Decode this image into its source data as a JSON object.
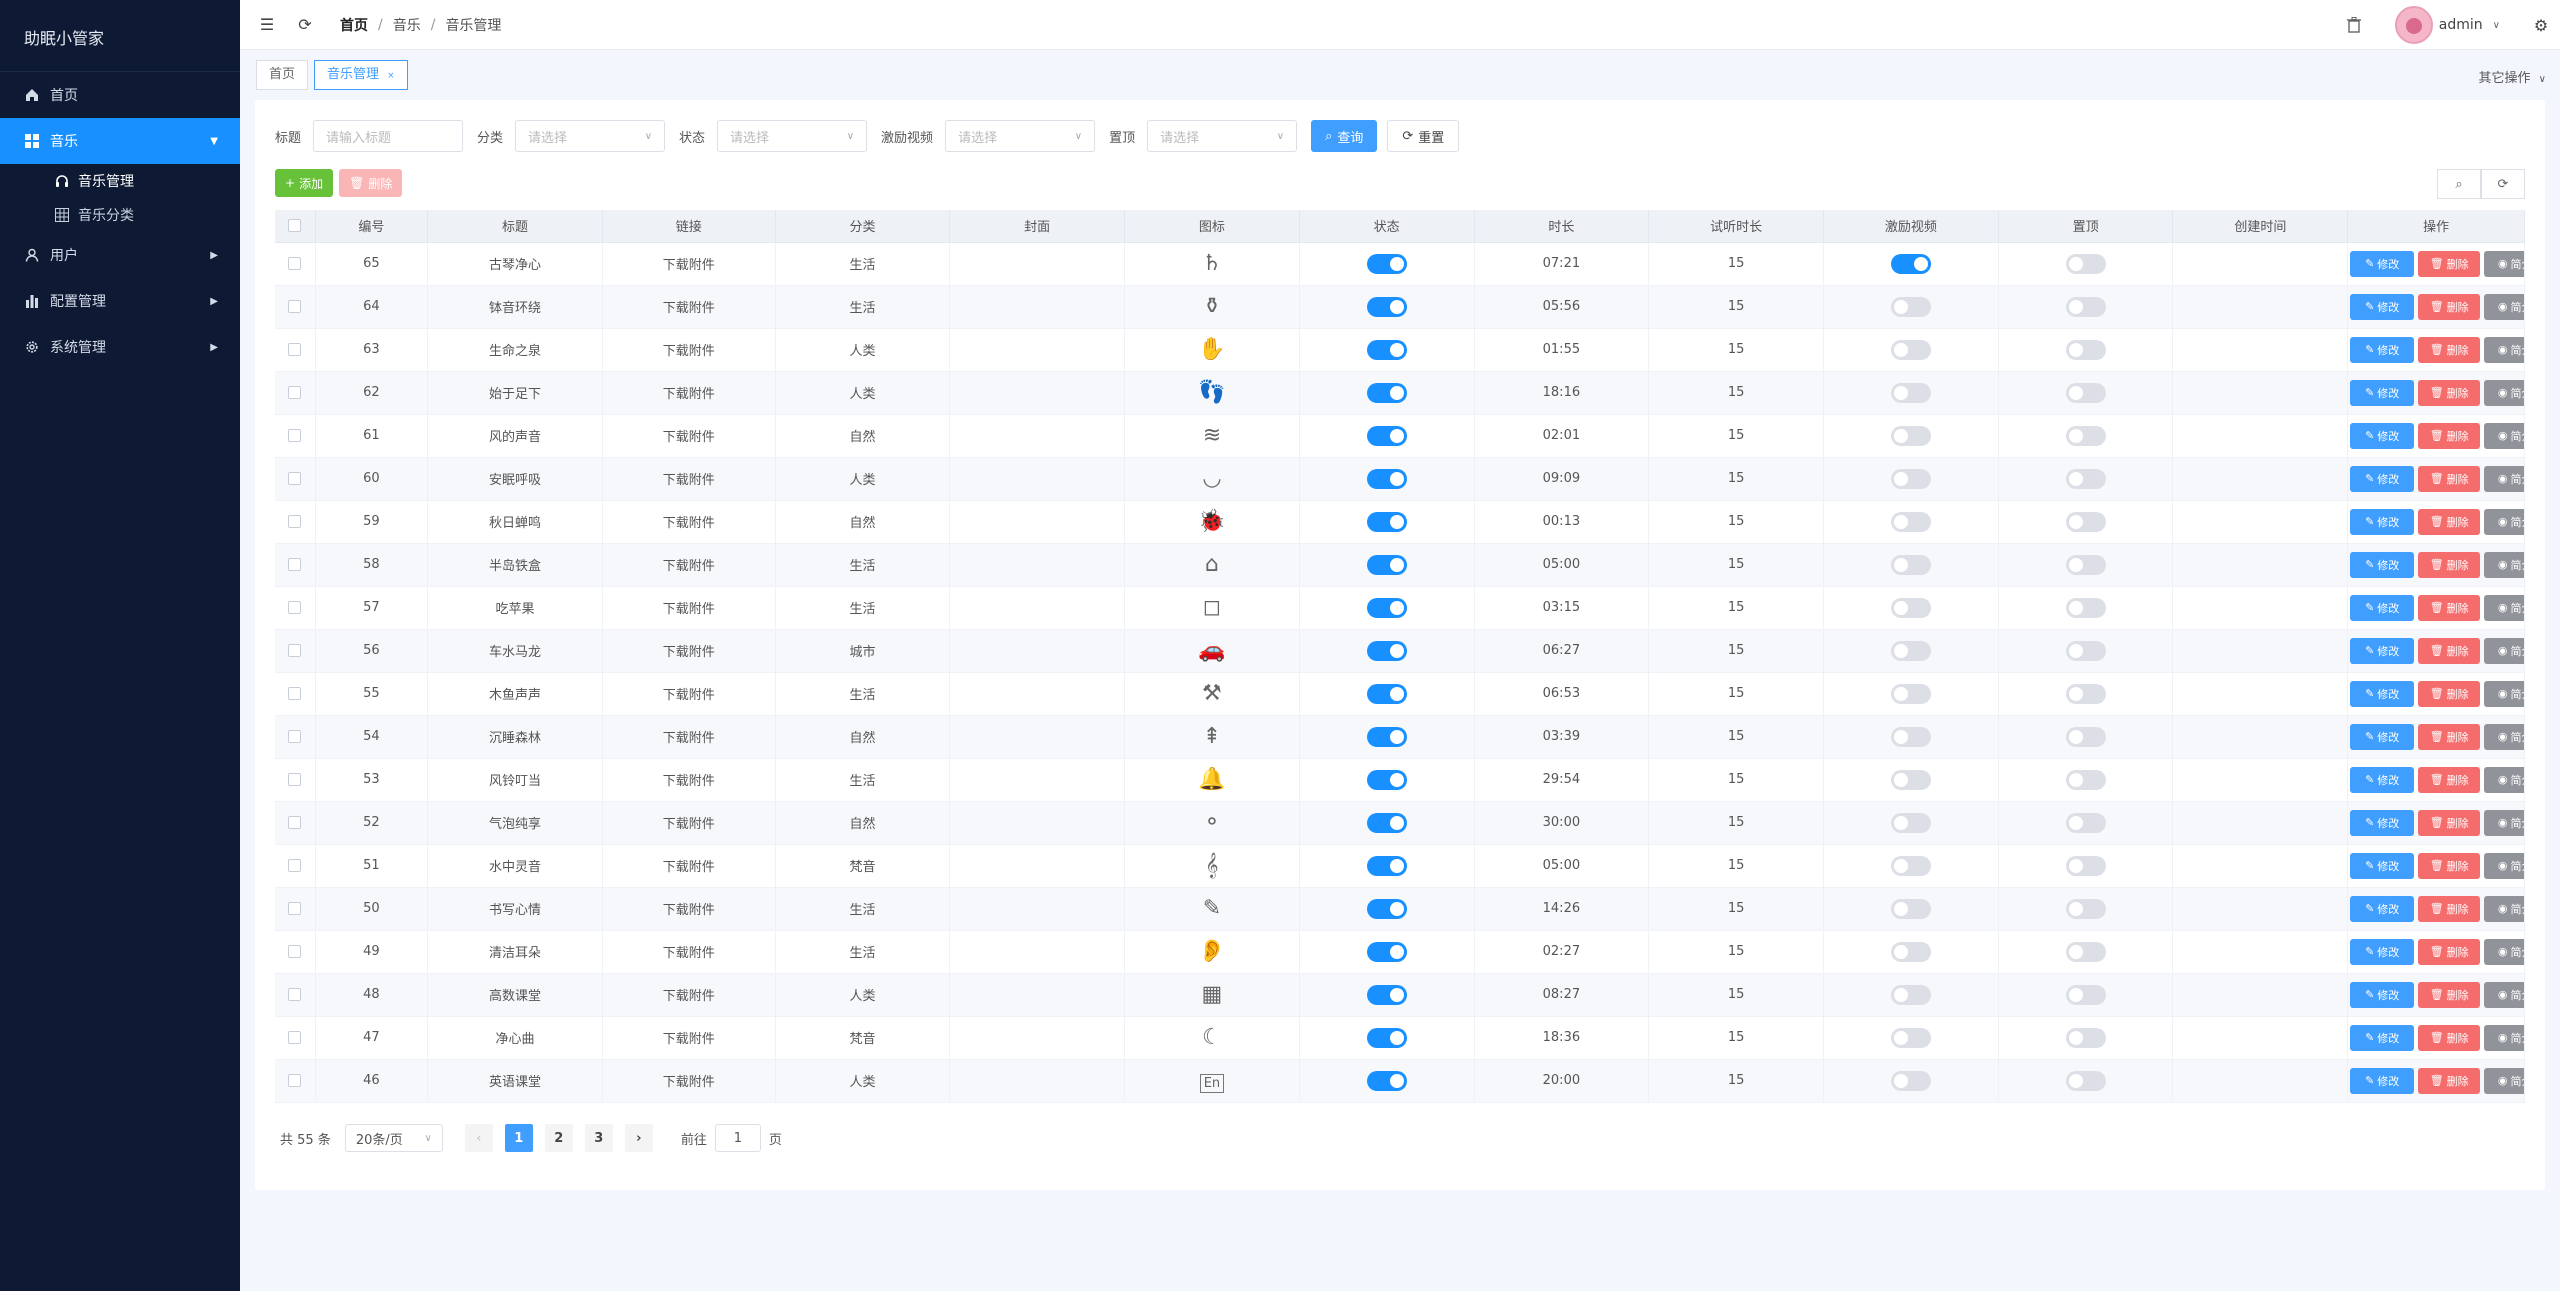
{
  "app": {
    "title": "助眠小管家"
  },
  "sidebar": {
    "items": [
      {
        "label": "首页",
        "icon": "home-icon"
      },
      {
        "label": "音乐",
        "icon": "grid-icon",
        "active": true,
        "expanded": true,
        "children": [
          {
            "label": "音乐管理",
            "icon": "headphones-icon",
            "active": true
          },
          {
            "label": "音乐分类",
            "icon": "table-icon"
          }
        ]
      },
      {
        "label": "用户",
        "icon": "user-icon"
      },
      {
        "label": "配置管理",
        "icon": "bar-chart-icon"
      },
      {
        "label": "系统管理",
        "icon": "gear-icon"
      }
    ]
  },
  "header": {
    "breadcrumb": [
      "首页",
      "音乐",
      "音乐管理"
    ],
    "username": "admin"
  },
  "tabs": {
    "items": [
      "首页",
      "音乐管理"
    ],
    "other_ops": "其它操作"
  },
  "search": {
    "title_label": "标题",
    "title_placeholder": "请输入标题",
    "category_label": "分类",
    "category_placeholder": "请选择",
    "status_label": "状态",
    "status_placeholder": "请选择",
    "video_label": "激励视频",
    "video_placeholder": "请选择",
    "top_label": "置顶",
    "top_placeholder": "请选择",
    "query_btn": "查询",
    "reset_btn": "重置"
  },
  "toolbar": {
    "add": "添加",
    "delete": "删除"
  },
  "table": {
    "headers": [
      "编号",
      "标题",
      "链接",
      "分类",
      "封面",
      "图标",
      "状态",
      "时长",
      "试听时长",
      "激励视频",
      "置顶",
      "创建时间",
      "操作"
    ],
    "link_text": "下载附件",
    "op_edit": "修改",
    "op_delete": "删除",
    "op_info": "简介",
    "rows": [
      {
        "id": "65",
        "title": "古琴净心",
        "category": "生活",
        "icon": "lyre",
        "status": true,
        "duration": "07:21",
        "trial": "15",
        "video": true,
        "top": false
      },
      {
        "id": "64",
        "title": "钵音环绕",
        "category": "生活",
        "icon": "mortar",
        "status": true,
        "duration": "05:56",
        "trial": "15",
        "video": false,
        "top": false
      },
      {
        "id": "63",
        "title": "生命之泉",
        "category": "人类",
        "icon": "hand",
        "status": true,
        "duration": "01:55",
        "trial": "15",
        "video": false,
        "top": false
      },
      {
        "id": "62",
        "title": "始于足下",
        "category": "人类",
        "icon": "footprints",
        "status": true,
        "duration": "18:16",
        "trial": "15",
        "video": false,
        "top": false
      },
      {
        "id": "61",
        "title": "风的声音",
        "category": "自然",
        "icon": "wind",
        "status": true,
        "duration": "02:01",
        "trial": "15",
        "video": false,
        "top": false
      },
      {
        "id": "60",
        "title": "安眠呼吸",
        "category": "人类",
        "icon": "lips",
        "status": true,
        "duration": "09:09",
        "trial": "15",
        "video": false,
        "top": false
      },
      {
        "id": "59",
        "title": "秋日蝉鸣",
        "category": "自然",
        "icon": "bug",
        "status": true,
        "duration": "00:13",
        "trial": "15",
        "video": false,
        "top": false
      },
      {
        "id": "58",
        "title": "半岛铁盒",
        "category": "生活",
        "icon": "music-box",
        "status": true,
        "duration": "05:00",
        "trial": "15",
        "video": false,
        "top": false
      },
      {
        "id": "57",
        "title": "吃苹果",
        "category": "生活",
        "icon": "apple",
        "status": true,
        "duration": "03:15",
        "trial": "15",
        "video": false,
        "top": false
      },
      {
        "id": "56",
        "title": "车水马龙",
        "category": "城市",
        "icon": "car",
        "status": true,
        "duration": "06:27",
        "trial": "15",
        "video": false,
        "top": false
      },
      {
        "id": "55",
        "title": "木鱼声声",
        "category": "生活",
        "icon": "mallet",
        "status": true,
        "duration": "06:53",
        "trial": "15",
        "video": false,
        "top": false
      },
      {
        "id": "54",
        "title": "沉睡森林",
        "category": "自然",
        "icon": "trees",
        "status": true,
        "duration": "03:39",
        "trial": "15",
        "video": false,
        "top": false
      },
      {
        "id": "53",
        "title": "风铃叮当",
        "category": "生活",
        "icon": "bell",
        "status": true,
        "duration": "29:54",
        "trial": "15",
        "video": false,
        "top": false
      },
      {
        "id": "52",
        "title": "气泡纯享",
        "category": "自然",
        "icon": "bubbles",
        "status": true,
        "duration": "30:00",
        "trial": "15",
        "video": false,
        "top": false
      },
      {
        "id": "51",
        "title": "水中灵音",
        "category": "梵音",
        "icon": "treble-clef",
        "status": true,
        "duration": "05:00",
        "trial": "15",
        "video": false,
        "top": false
      },
      {
        "id": "50",
        "title": "书写心情",
        "category": "生活",
        "icon": "pen",
        "status": true,
        "duration": "14:26",
        "trial": "15",
        "video": false,
        "top": false
      },
      {
        "id": "49",
        "title": "清洁耳朵",
        "category": "生活",
        "icon": "ear",
        "status": true,
        "duration": "02:27",
        "trial": "15",
        "video": false,
        "top": false
      },
      {
        "id": "48",
        "title": "高数课堂",
        "category": "人类",
        "icon": "abacus",
        "status": true,
        "duration": "08:27",
        "trial": "15",
        "video": false,
        "top": false
      },
      {
        "id": "47",
        "title": "净心曲",
        "category": "梵音",
        "icon": "moon",
        "status": true,
        "duration": "18:36",
        "trial": "15",
        "video": false,
        "top": false
      },
      {
        "id": "46",
        "title": "英语课堂",
        "category": "人类",
        "icon": "en-box",
        "status": true,
        "duration": "20:00",
        "trial": "15",
        "video": false,
        "top": false
      }
    ]
  },
  "pagination": {
    "total_text": "共 55 条",
    "page_size": "20条/页",
    "pages": [
      "1",
      "2",
      "3"
    ],
    "current": "1",
    "goto_label": "前往",
    "goto_value": "1",
    "goto_suffix": "页"
  }
}
